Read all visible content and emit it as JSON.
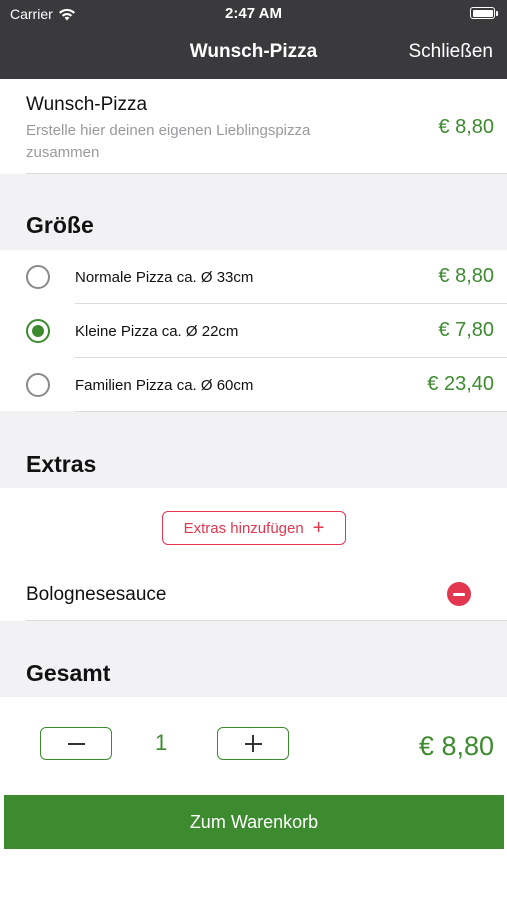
{
  "status_bar": {
    "carrier": "Carrier",
    "time": "2:47 AM",
    "icons": [
      "wifi-icon",
      "battery-icon"
    ]
  },
  "nav": {
    "title": "Wunsch-Pizza",
    "close_label": "Schließen"
  },
  "product": {
    "name": "Wunsch-Pizza",
    "description": "Erstelle hier deinen eigenen Lieblingspizza zusammen",
    "price": "€ 8,80"
  },
  "sizes": {
    "heading": "Größe",
    "options": [
      {
        "label": "Normale Pizza ca. Ø 33cm",
        "price": "€ 8,80",
        "selected": false
      },
      {
        "label": "Kleine Pizza ca. Ø 22cm",
        "price": "€ 7,80",
        "selected": true
      },
      {
        "label": "Familien Pizza ca. Ø 60cm",
        "price": "€ 23,40",
        "selected": false
      }
    ]
  },
  "extras": {
    "heading": "Extras",
    "add_label": "Extras hinzufügen",
    "items": [
      {
        "name": "Bolognesesauce"
      }
    ]
  },
  "total": {
    "heading": "Gesamt",
    "quantity": "1",
    "price": "€ 8,80",
    "cart_label": "Zum Warenkorb"
  },
  "colors": {
    "accent_green": "#3d8b2f",
    "accent_red": "#e2374f",
    "nav_background": "#3a3a3c"
  }
}
